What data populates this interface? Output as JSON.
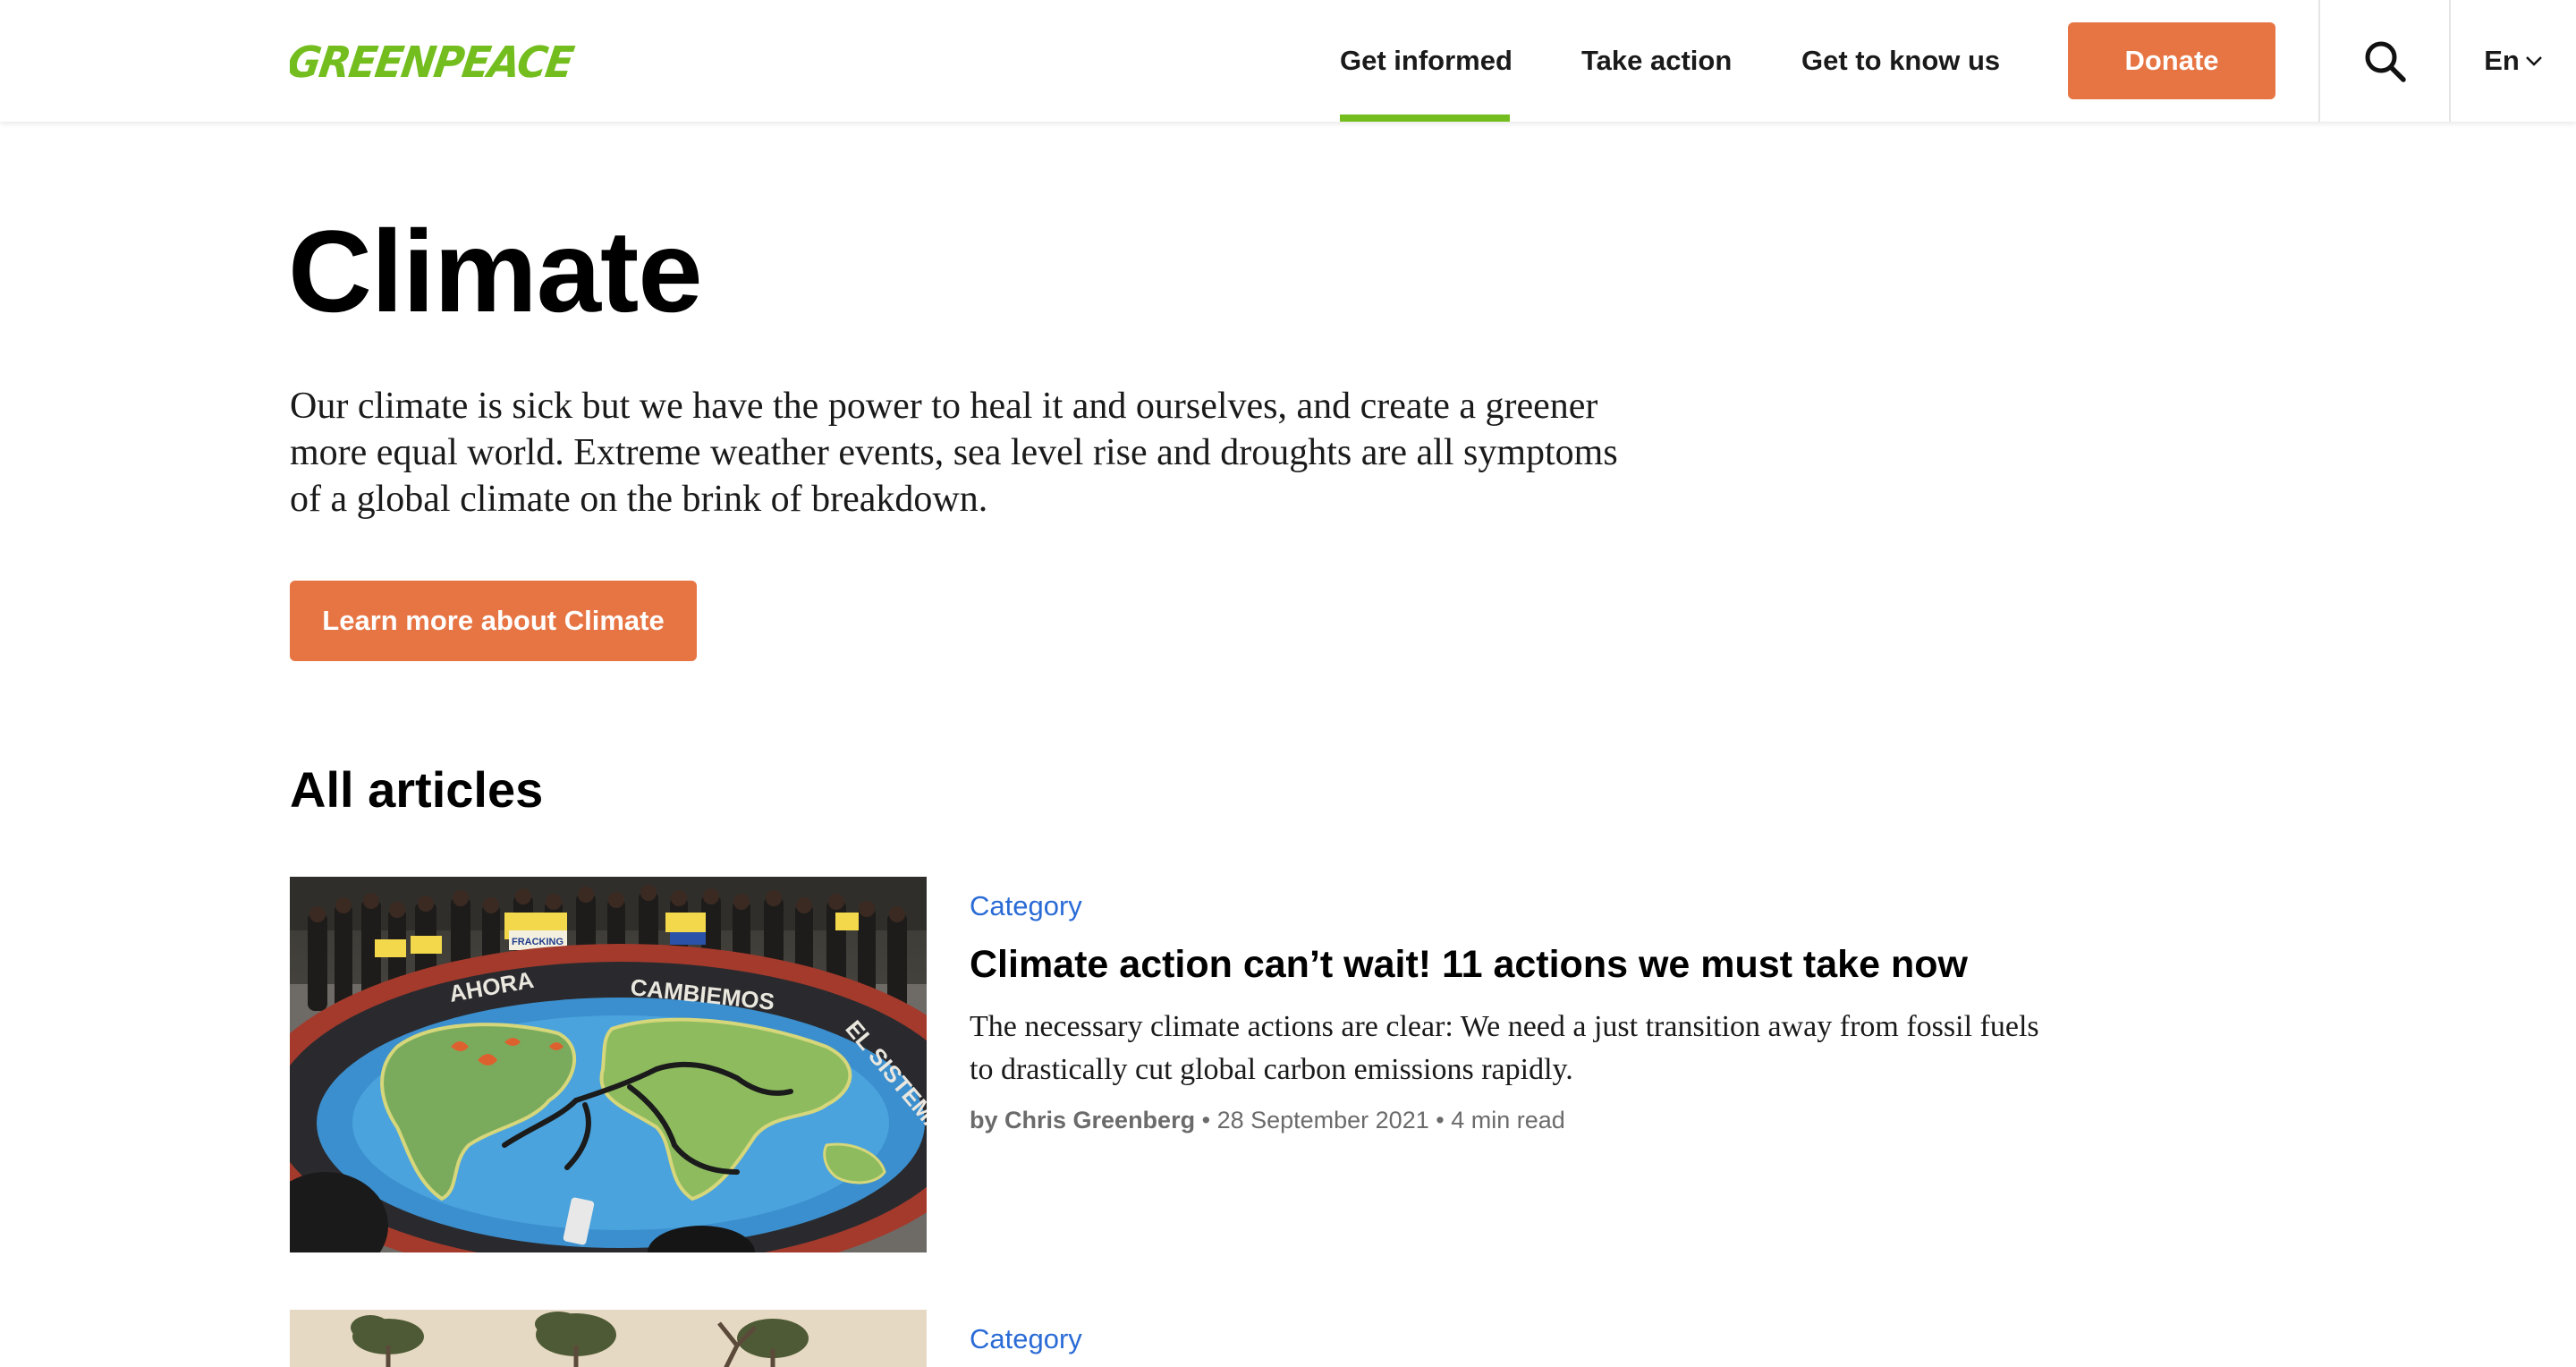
{
  "header": {
    "logo_text": "GREENPEACE",
    "nav": [
      {
        "label": "Get informed",
        "active": true
      },
      {
        "label": "Take action"
      },
      {
        "label": "Get to know us"
      }
    ],
    "donate_label": "Donate",
    "language_label": "En",
    "icons": [
      "search-icon",
      "chevron-down-icon"
    ]
  },
  "main": {
    "title": "Climate",
    "intro": "Our climate is sick but we have the power to heal it and ourselves, and create a greener more equal world. Extreme weather events, sea level rise and droughts are all symptoms of a global climate on the brink of breakdown.",
    "cta_label": "Learn more about Climate",
    "section_title": "All articles",
    "articles": [
      {
        "category": "Category",
        "title": "Climate action can’t wait! 11 actions we must take now",
        "excerpt": "The necessary climate actions are clear: We need a just transition away from fossil fuels to drastically cut global carbon emissions rapidly.",
        "author": "by Chris Greenberg",
        "separator": "•",
        "date": "28 September 2021",
        "read_time": "4 min read",
        "image_text": {
          "circle_words": [
            "AHORA",
            "CAMBIEMOS",
            "EL SISTEMA"
          ],
          "sign": "FRACKING"
        }
      },
      {
        "category": "Category"
      }
    ]
  },
  "colors": {
    "brand_green": "#73be1e",
    "accent_orange": "#e77443",
    "link_blue": "#2a6bd6",
    "meta_gray": "#6b6b6b"
  }
}
